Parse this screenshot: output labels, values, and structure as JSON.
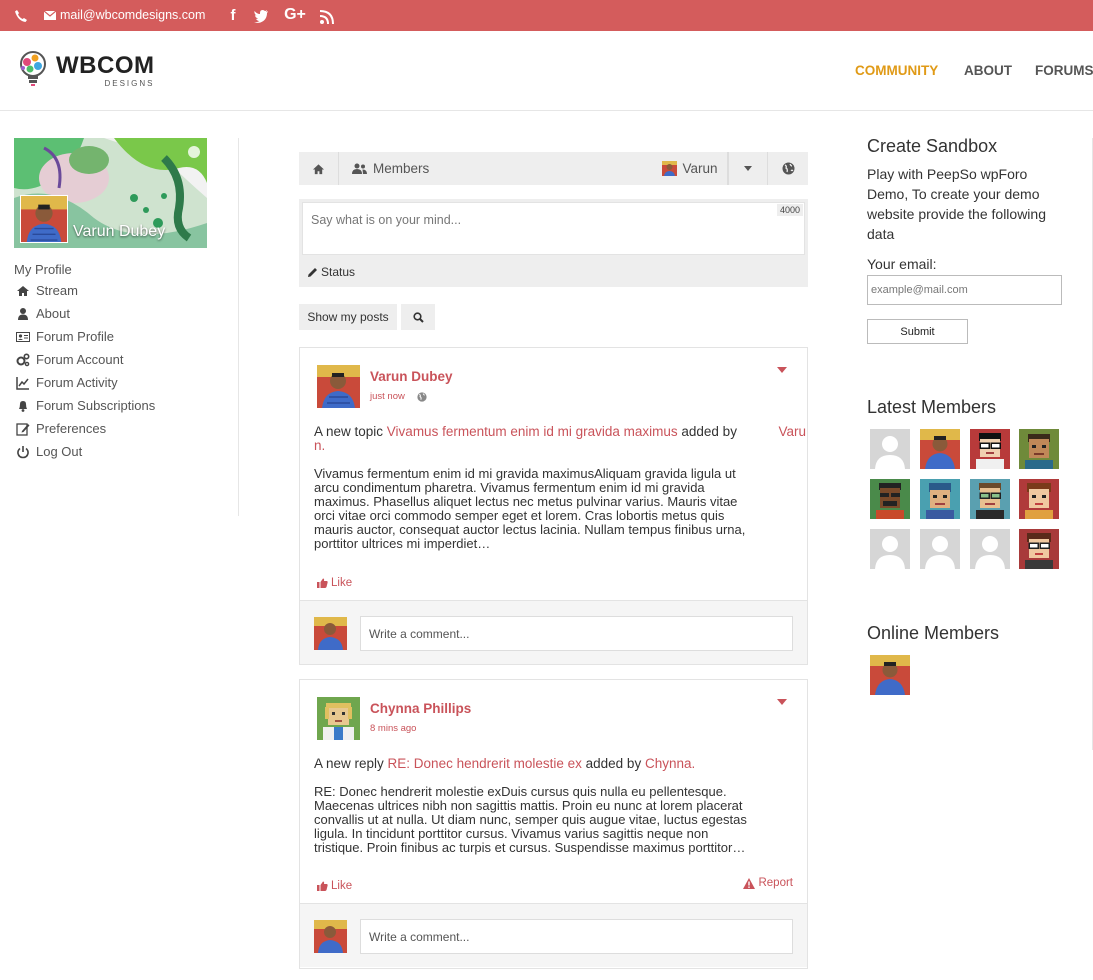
{
  "topbar": {
    "email": "mail@wbcomdesigns.com",
    "social": [
      {
        "icon": "facebook-icon",
        "glyph": "f"
      },
      {
        "icon": "twitter-icon",
        "glyph": "t"
      },
      {
        "icon": "google-plus-icon",
        "glyph": "G+"
      },
      {
        "icon": "rss-icon",
        "glyph": "rss"
      }
    ]
  },
  "logo": {
    "main": "WBCOM",
    "sub": "DESIGNS"
  },
  "nav": [
    "COMMUNITY",
    "ABOUT",
    "FORUMS"
  ],
  "profile": {
    "name": "Varun Dubey",
    "section_title": "My Profile",
    "menu": [
      {
        "label": "Stream",
        "icon": "home-icon"
      },
      {
        "label": "About",
        "icon": "user-icon"
      },
      {
        "label": "Forum Profile",
        "icon": "id-card-icon"
      },
      {
        "label": "Forum Account",
        "icon": "gears-icon"
      },
      {
        "label": "Forum Activity",
        "icon": "line-chart-icon"
      },
      {
        "label": "Forum Subscriptions",
        "icon": "bell-icon"
      },
      {
        "label": "Preferences",
        "icon": "edit-icon"
      },
      {
        "label": "Log Out",
        "icon": "power-icon"
      }
    ]
  },
  "tabs": {
    "members": "Members",
    "user": "Varun"
  },
  "postbox": {
    "placeholder": "Say what is on your mind...",
    "counter": "4000",
    "status": "Status"
  },
  "filters": {
    "show_my_posts": "Show my posts"
  },
  "posts": [
    {
      "author": "Varun Dubey",
      "time": "just now",
      "headline_prefix": "A new topic ",
      "headline_link": "Vivamus fermentum enim id mi gravida maximus",
      "headline_mid": " added by ",
      "headline_author_line1": "Varu",
      "headline_author_line2": "n.",
      "body": [
        "Vivamus fermentum enim id mi gravida maximusAliquam gravida ligula ut",
        "arcu condimentum pharetra. Vivamus fermentum enim id mi gravida",
        "maximus. Phasellus aliquet lectus nec metus pulvinar varius. Mauris vitae",
        "orci vitae orci commodo semper eget et lorem. Cras lobortis metus quis",
        "mauris auctor, consequat auctor lectus lacinia. Nullam tempus finibus urna,",
        "porttitor ultrices mi imperdiet…"
      ],
      "like": "Like",
      "comment_placeholder": "Write a comment..."
    },
    {
      "author": "Chynna Phillips",
      "time": "8 mins ago",
      "headline_prefix": "A new reply ",
      "headline_link": "RE: Donec hendrerit molestie ex",
      "headline_mid": " added by ",
      "headline_author": "Chynna.",
      "body": [
        "RE: Donec hendrerit molestie exDuis cursus quis nulla eu pellentesque.",
        "Maecenas ultrices nibh non sagittis mattis. Proin eu nunc at lorem placerat",
        "convallis ut at nulla. Ut diam nunc, semper quis augue vitae, luctus egestas",
        "ligula. In tincidunt porttitor cursus. Vivamus varius sagittis neque non",
        "tristique. Proin finibus ac turpis et cursus. Suspendisse maximus porttitor…"
      ],
      "like": "Like",
      "report": "Report",
      "comment_placeholder": "Write a comment..."
    }
  ],
  "sandbox": {
    "title": "Create Sandbox",
    "text": "Play with PeepSo wpForo Demo, To create your demo website provide the following data",
    "email_label": "Your email:",
    "email_placeholder": "example@mail.com",
    "submit": "Submit"
  },
  "latest_members": {
    "title": "Latest Members",
    "avatars": [
      "default",
      "photo",
      "pixel-red-glasses",
      "pixel-green",
      "pixel-dark-glasses",
      "pixel-teal",
      "pixel-green-glasses",
      "pixel-red",
      "default",
      "default",
      "default",
      "pixel-red-glasses"
    ]
  },
  "online_members": {
    "title": "Online Members"
  },
  "colors": {
    "accent": "#c9535a",
    "topbar": "#d45c5c",
    "nav_active": "#e09a16"
  }
}
